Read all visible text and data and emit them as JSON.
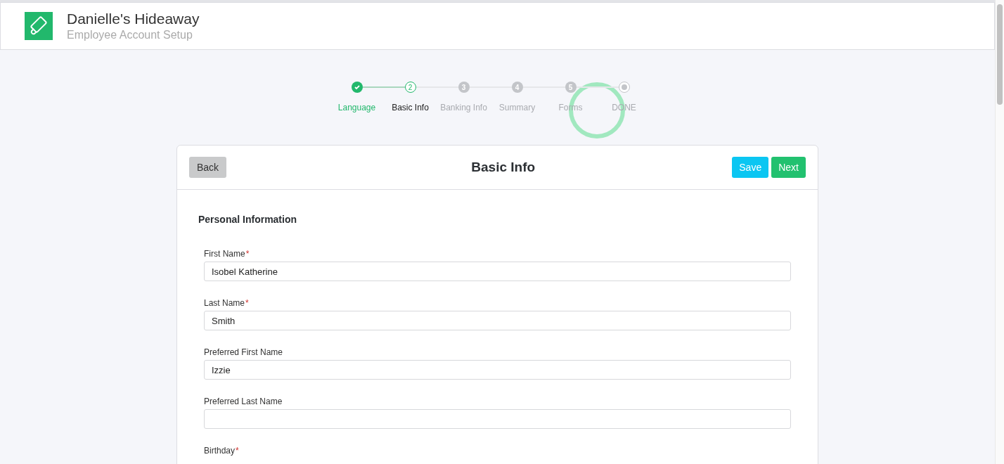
{
  "header": {
    "title": "Danielle's Hideaway",
    "subtitle": "Employee Account Setup"
  },
  "steps": [
    {
      "label": "Language",
      "kind": "check",
      "completed": true,
      "selected": false
    },
    {
      "label": "Basic Info",
      "kind": "number",
      "number": "2",
      "completed": false,
      "selected": true
    },
    {
      "label": "Banking Info",
      "kind": "number",
      "number": "3",
      "completed": false,
      "selected": false
    },
    {
      "label": "Summary",
      "kind": "number",
      "number": "4",
      "completed": false,
      "selected": false
    },
    {
      "label": "Forms",
      "kind": "number",
      "number": "5",
      "completed": false,
      "selected": false
    },
    {
      "label": "DONE",
      "kind": "dot",
      "completed": false,
      "selected": false
    }
  ],
  "card": {
    "back_button": "Back",
    "title": "Basic Info",
    "save_button": "Save",
    "next_button": "Next",
    "section_title": "Personal Information",
    "fields": [
      {
        "label": "First Name",
        "kind": "input",
        "required_mark": "*",
        "value": "Isobel Katherine"
      },
      {
        "label": "Last Name",
        "kind": "input",
        "required_mark": "*",
        "value": "Smith"
      },
      {
        "label": "Preferred First Name",
        "kind": "input",
        "value": "Izzie"
      },
      {
        "label": "Preferred Last Name",
        "kind": "input"
      },
      {
        "label": "Birthday",
        "kind": "label",
        "required_mark": "*"
      }
    ]
  }
}
